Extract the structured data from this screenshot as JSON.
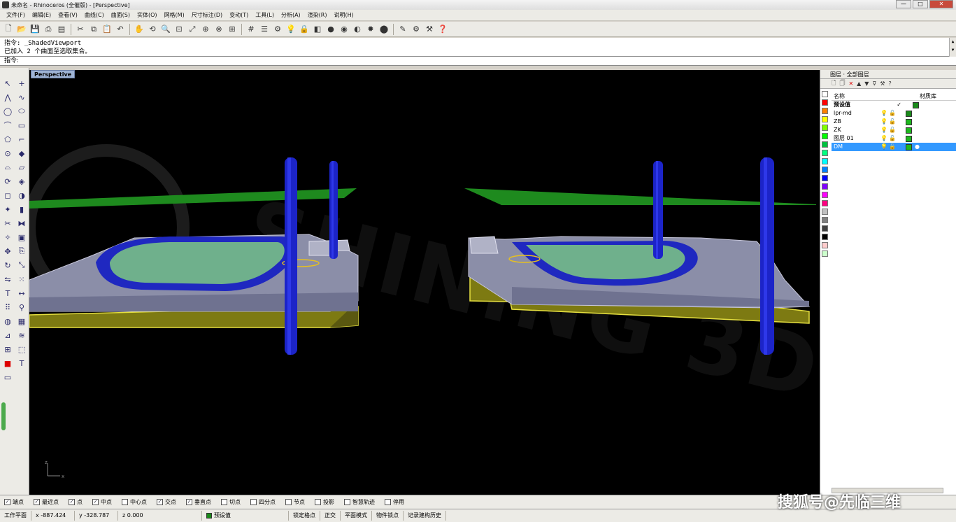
{
  "window": {
    "title": "未命名 - Rhinoceros (全催版) - [Perspective]",
    "minimize": "—",
    "maximize": "□",
    "close": "✕"
  },
  "menu": [
    "文件(F)",
    "编辑(E)",
    "查看(V)",
    "曲线(C)",
    "曲面(S)",
    "实体(O)",
    "网格(M)",
    "尺寸标注(D)",
    "变动(T)",
    "工具(L)",
    "分析(A)",
    "渲染(R)",
    "说明(H)"
  ],
  "toolbar_icons": [
    "new-icon",
    "open-icon",
    "save-icon",
    "print-icon",
    "template-icon",
    "cut-icon",
    "copy-icon",
    "paste-icon",
    "undo-icon",
    "pan-icon",
    "rotate-view-icon",
    "zoom-icon",
    "zoom-window-icon",
    "zoom-extents-icon",
    "zoom-selected-icon",
    "zoom-all-icon",
    "four-view-icon",
    "grid-icon",
    "layer-icon",
    "properties-icon",
    "light-icon",
    "lock-icon",
    "material-icon",
    "color-icon",
    "render-icon",
    "shade-icon",
    "sun-icon",
    "sphere-icon",
    "edit-icon",
    "settings-icon",
    "options-icon",
    "help-icon"
  ],
  "command": {
    "line1": "指令: _ShadedViewport",
    "line2": "已加入 2 个曲面至选取集合。",
    "prompt": "指令:"
  },
  "viewport": {
    "label": "Perspective",
    "watermark": "SHINING 3D",
    "axis_x": "x",
    "axis_z": "z",
    "bg": "#000000"
  },
  "layers": {
    "header": "图层 · 全部图层",
    "col_name": "名称",
    "col_material": "材质库",
    "rows": [
      {
        "name": "预设值",
        "check": "✓",
        "color": "#1a8a1a",
        "selected": false
      },
      {
        "name": "lpr-md",
        "check": "",
        "color": "#1a8a1a",
        "selected": false
      },
      {
        "name": "ZB",
        "check": "",
        "color": "#1db81d",
        "selected": false
      },
      {
        "name": "ZK",
        "check": "",
        "color": "#1db81d",
        "selected": false
      },
      {
        "name": "图层 01",
        "check": "",
        "color": "#1db81d",
        "selected": false
      },
      {
        "name": "DM",
        "check": "",
        "color": "#1db81d",
        "selected": true
      }
    ],
    "swatches": [
      "#ffffff",
      "#ff0000",
      "#ff8000",
      "#ffff00",
      "#80ff00",
      "#00ff00",
      "#00c040",
      "#00ff80",
      "#00ffff",
      "#0080ff",
      "#0000ff",
      "#8000ff",
      "#ff00ff",
      "#ff0080",
      "#c0c0c0",
      "#808080",
      "#404040",
      "#000000",
      "#ffcccc",
      "#ccffcc"
    ]
  },
  "osnap": [
    {
      "label": "端点",
      "checked": true
    },
    {
      "label": "最近点",
      "checked": true
    },
    {
      "label": "点",
      "checked": true
    },
    {
      "label": "中点",
      "checked": true
    },
    {
      "label": "中心点",
      "checked": false
    },
    {
      "label": "交点",
      "checked": true
    },
    {
      "label": "垂直点",
      "checked": true
    },
    {
      "label": "切点",
      "checked": false
    },
    {
      "label": "四分点",
      "checked": false
    },
    {
      "label": "节点",
      "checked": false
    },
    {
      "label": "投影",
      "checked": false
    },
    {
      "label": "智慧轨迹",
      "checked": false
    },
    {
      "label": "停用",
      "checked": false
    }
  ],
  "status": {
    "plane": "工作平面",
    "x": "x -887.424",
    "y": "y -328.787",
    "z": "z 0.000",
    "layer": "预设值",
    "snap": "锁定格点",
    "ortho": "正交",
    "planar": "平面模式",
    "osnap": "物件锁点",
    "history": "记录建构历史"
  },
  "credit": "搜狐号@先临三维"
}
